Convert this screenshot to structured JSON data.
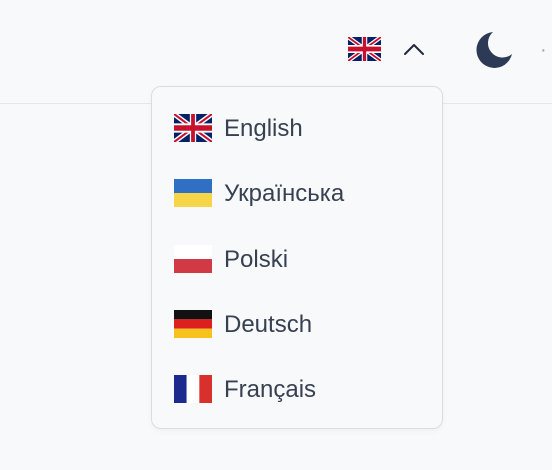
{
  "header": {
    "current_language_flag": "uk-flag-icon",
    "chevron_icon": "chevron-up-icon",
    "theme_icon": "moon-icon",
    "more_icon": "dots-icon"
  },
  "language_menu": {
    "items": [
      {
        "label": "English",
        "flag": "uk-flag-icon"
      },
      {
        "label": "Українська",
        "flag": "ukraine-flag-icon"
      },
      {
        "label": "Polski",
        "flag": "poland-flag-icon"
      },
      {
        "label": "Deutsch",
        "flag": "germany-flag-icon"
      },
      {
        "label": "Français",
        "flag": "france-flag-icon"
      }
    ]
  },
  "colors": {
    "text": "#374151",
    "moon": "#2d3a55",
    "border": "#d9dde3",
    "background": "#f8f9fb"
  }
}
